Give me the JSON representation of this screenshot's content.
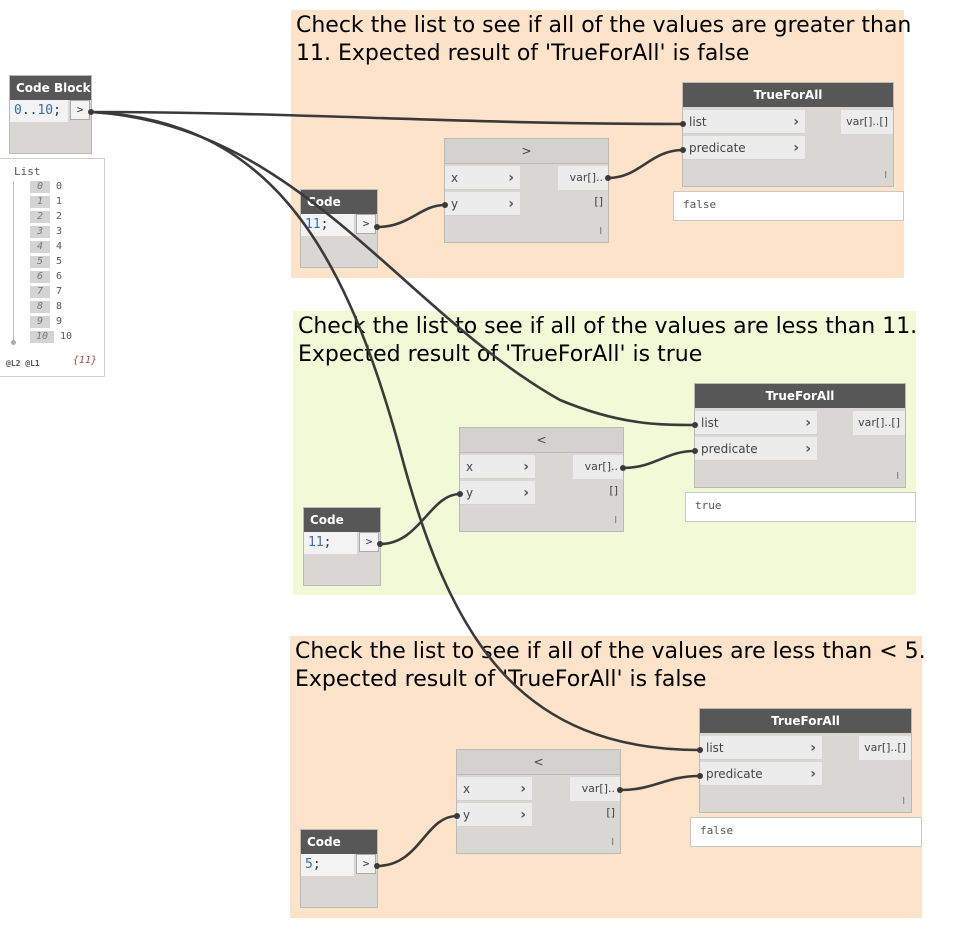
{
  "colors": {
    "group_orange": "#fde3c9",
    "group_green": "#f1f9d6",
    "node_header": "#575757",
    "node_body": "#d9d7d3",
    "wire": "#3a3a3a",
    "number_blue": "#2f6fb5"
  },
  "groups": [
    {
      "title_line1": "Check the list to see if all of the values are greater than",
      "title_line2": "11. Expected result of 'TrueForAll' is false"
    },
    {
      "title_line1": "Check the list to see if all of the values are less than 11.",
      "title_line2": "Expected result of 'TrueForAll' is true"
    },
    {
      "title_line1": "Check the list to see if all of the values are less than < 5.",
      "title_line2": "Expected result of 'TrueForAll' is false"
    }
  ],
  "code_block_main": {
    "title": "Code Block",
    "code_num1": "0",
    "code_range": "..",
    "code_num2": "10",
    "code_end": ";",
    "output": ">"
  },
  "list_preview": {
    "header": "List",
    "items": [
      {
        "index": "0",
        "value": "0"
      },
      {
        "index": "1",
        "value": "1"
      },
      {
        "index": "2",
        "value": "2"
      },
      {
        "index": "3",
        "value": "3"
      },
      {
        "index": "4",
        "value": "4"
      },
      {
        "index": "5",
        "value": "5"
      },
      {
        "index": "6",
        "value": "6"
      },
      {
        "index": "7",
        "value": "7"
      },
      {
        "index": "8",
        "value": "8"
      },
      {
        "index": "9",
        "value": "9"
      },
      {
        "index": "10",
        "value": "10"
      }
    ],
    "levels": "@L2 @L1",
    "count": "{11}"
  },
  "code_blocks": [
    {
      "title": "Code Block",
      "code_num": "11",
      "code_end": ";",
      "output": ">"
    },
    {
      "title": "Code Block",
      "code_num": "11",
      "code_end": ";",
      "output": ">"
    },
    {
      "title": "Code Block",
      "code_num": "5",
      "code_end": ";",
      "output": ">"
    }
  ],
  "compare_nodes": [
    {
      "title": ">",
      "input_x": "x",
      "input_y": "y",
      "output": "var[]..[]",
      "lacing": "l"
    },
    {
      "title": "<",
      "input_x": "x",
      "input_y": "y",
      "output": "var[]..[]",
      "lacing": "l"
    },
    {
      "title": "<",
      "input_x": "x",
      "input_y": "y",
      "output": "var[]..[]",
      "lacing": "l"
    }
  ],
  "trueforall_nodes": [
    {
      "title": "TrueForAll",
      "input_list": "list",
      "input_predicate": "predicate",
      "output": "var[]..[]",
      "lacing": "l",
      "result": "false"
    },
    {
      "title": "TrueForAll",
      "input_list": "list",
      "input_predicate": "predicate",
      "output": "var[]..[]",
      "lacing": "l",
      "result": "true"
    },
    {
      "title": "TrueForAll",
      "input_list": "list",
      "input_predicate": "predicate",
      "output": "var[]..[]",
      "lacing": "l",
      "result": "false"
    }
  ],
  "chevron": "›"
}
